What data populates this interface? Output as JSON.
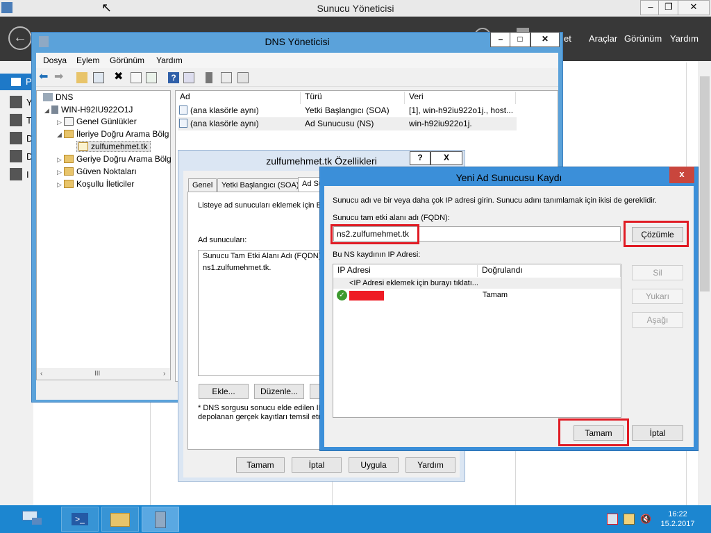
{
  "server_manager": {
    "title": "Sunucu Yöneticisi",
    "menu": [
      "et",
      "Araçlar",
      "Görünüm",
      "Yardım"
    ],
    "sidebar_letters": [
      "P",
      "Y",
      "T",
      "D",
      "D",
      "I"
    ]
  },
  "dns_manager": {
    "title": "DNS Yöneticisi",
    "menu": [
      "Dosya",
      "Eylem",
      "Görünüm",
      "Yardım"
    ],
    "tree": {
      "root": "DNS",
      "server": "WIN-H92IU922O1J",
      "items": [
        "Genel Günlükler",
        "İleriye Doğru Arama Bölg",
        "zulfumehmet.tk",
        "Geriye Doğru Arama Bölg",
        "Güven Noktaları",
        "Koşullu İleticiler"
      ]
    },
    "columns": [
      "Ad",
      "Türü",
      "Veri"
    ],
    "rows": [
      {
        "name": "(ana klasörle aynı)",
        "type": "Yetki Başlangıcı (SOA)",
        "data": "[1], win-h92iu922o1j., host..."
      },
      {
        "name": "(ana klasörle aynı)",
        "type": "Ad Sunucusu (NS)",
        "data": "win-h92iu922o1j."
      }
    ],
    "scrollbar_glyph": "III"
  },
  "properties": {
    "title": "zulfumehmet.tk Özellikleri",
    "help_glyph": "?",
    "close_glyph": "X",
    "tabs": [
      "Genel",
      "Yetki Başlangıcı (SOA)",
      "Ad Su"
    ],
    "description": "Listeye ad sunucuları eklemek için Ekl",
    "ns_label": "Ad sunucuları:",
    "ns_column": "Sunucu Tam Etki Alanı Adı (FQDN)",
    "ns_items": [
      "ns1.zulfumehmet.tk."
    ],
    "buttons": [
      "Ekle...",
      "Düzenle..."
    ],
    "footnote_1": "* DNS sorgusu sonucu elde edilen IP",
    "footnote_2": "depolanan gerçek kayıtları temsil etm",
    "bottom_buttons": [
      "Tamam",
      "İptal",
      "Uygula",
      "Yardım"
    ]
  },
  "new_ns": {
    "title": "Yeni Ad Sunucusu Kaydı",
    "close_glyph": "x",
    "instruction": "Sunucu adı ve bir veya daha çok IP adresi girin. Sunucu adını tanımlamak için ikisi de gereklidir.",
    "fqdn_label": "Sunucu tam etki alanı adı (FQDN):",
    "fqdn_value": "ns2.zulfumehmet.tk",
    "resolve_button": "Çözümle",
    "ip_label": "Bu NS kaydının IP Adresi:",
    "ip_columns": [
      "IP Adresi",
      "Doğrulandı"
    ],
    "ip_add_hint": "<IP Adresi eklemek için burayı tıklatı...",
    "ip_status": "Tamam",
    "side_buttons": [
      "Sil",
      "Yukarı",
      "Aşağı"
    ],
    "ok_button": "Tamam",
    "cancel_button": "İptal"
  },
  "taskbar": {
    "time": "16:22",
    "date": "15.2.2017"
  },
  "colors": {
    "highlight_red": "#e01b24",
    "taskbar_blue": "#1c86d0",
    "dialog_frame_blue": "#3b8fd9"
  }
}
